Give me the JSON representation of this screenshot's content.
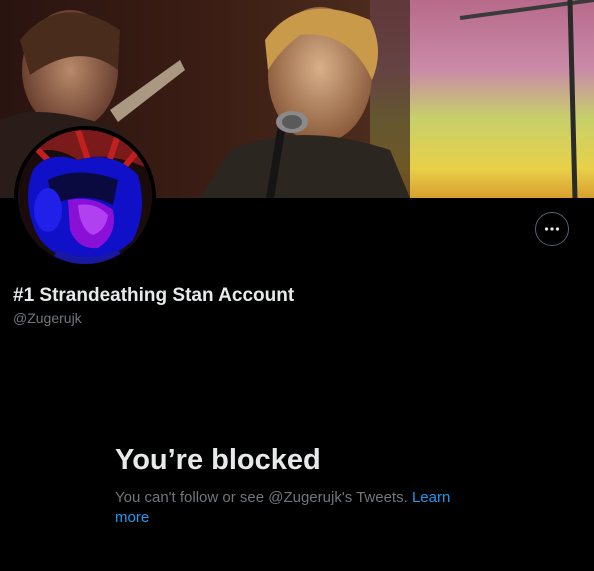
{
  "profile": {
    "display_name": "#1 Strandeathing Stan Account",
    "handle": "@Zugerujk"
  },
  "header": {
    "banner_icon": "concert-photo-banner",
    "avatar_icon": "cartoon-avatar",
    "more_icon": "more-horizontal-icon"
  },
  "blocked": {
    "title": "You’re blocked",
    "message": "You can't follow or see @Zugerujk's Tweets.",
    "learn_more": "Learn more"
  },
  "colors": {
    "background": "#000000",
    "primary_text": "#e7e9ea",
    "secondary_text": "#71767b",
    "link": "#1d9bf0",
    "border": "#536471"
  }
}
